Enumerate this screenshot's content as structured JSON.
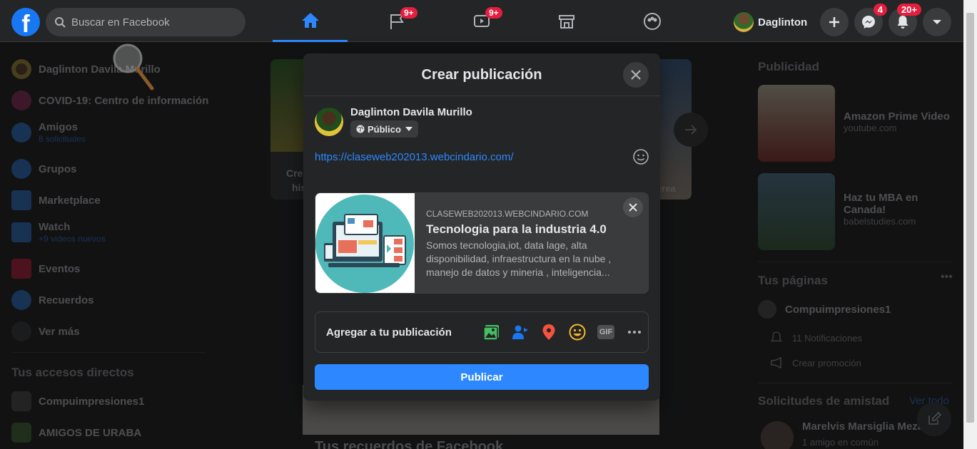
{
  "topbar": {
    "search_placeholder": "Buscar en Facebook",
    "nav_badges": [
      "9+",
      "9+"
    ],
    "user_name": "Daglinton",
    "messenger_badge": "4",
    "notifications_badge": "20+"
  },
  "left_sidebar": {
    "items": [
      {
        "label": "Daglinton Davila Murillo"
      },
      {
        "label": "COVID-19: Centro de información"
      },
      {
        "label": "Amigos",
        "sub": "8 solicitudes"
      },
      {
        "label": "Grupos"
      },
      {
        "label": "Marketplace"
      },
      {
        "label": "Watch",
        "sub": "+9 videos nuevos"
      },
      {
        "label": "Eventos"
      },
      {
        "label": "Recuerdos"
      },
      {
        "label": "Ver más"
      }
    ],
    "shortcuts_title": "Tus accesos directos",
    "shortcuts": [
      "Compuimpresiones1",
      "AMIGOS DE URABA"
    ]
  },
  "feed": {
    "story_create_text_1": "Cre",
    "story_create_text_2": "his",
    "story_caption": "erea",
    "memories_title": "Tus recuerdos de Facebook"
  },
  "right_sidebar": {
    "sponsored_title": "Publicidad",
    "ads": [
      {
        "title": "Amazon Prime Video",
        "domain": "youtube.com"
      },
      {
        "title": "Haz tu MBA en Canada!",
        "domain": "babelstudies.com"
      }
    ],
    "pages_title": "Tus páginas",
    "page_name": "Compuimpresiones1",
    "page_notifications": "11 Notificaciones",
    "page_promo": "Crear promoción",
    "friend_requests_title": "Solicitudes de amistad",
    "see_all": "Ver todo",
    "request_name": "Marelvis Marsiglia Meza",
    "request_mutual": "1 amigo en común"
  },
  "modal": {
    "title": "Crear publicación",
    "author": "Daglinton Davila Murillo",
    "privacy": "Público",
    "post_text": "https://claseweb202013.webcindario.com/",
    "link_preview": {
      "domain": "CLASEWEB202013.WEBCINDARIO.COM",
      "title": "Tecnologia para la industria 4.0",
      "description": "Somos tecnologia,iot, data lage, alta disponibilidad, infraestructura en la nube , manejo de datos y mineria , inteligencia..."
    },
    "add_to_post_label": "Agregar a tu publicación",
    "gif_label": "GIF",
    "publish_label": "Publicar"
  },
  "colors": {
    "accent": "#2d88ff",
    "brand": "#1877f2",
    "badge": "#e41e3f",
    "surface": "#242526",
    "background": "#18191a"
  }
}
